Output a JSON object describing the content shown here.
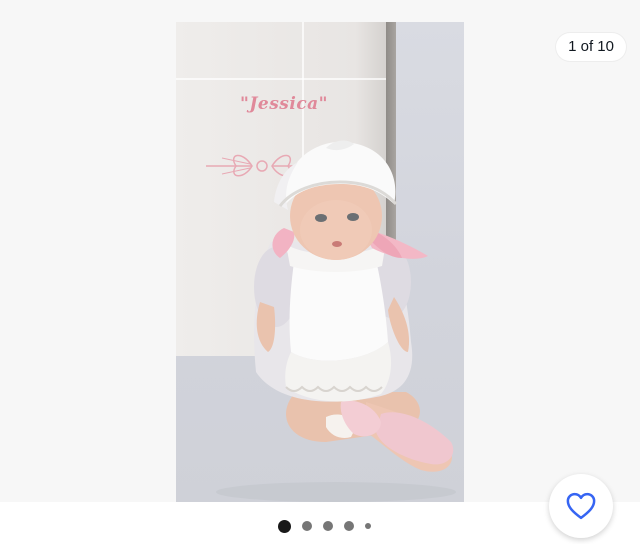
{
  "gallery": {
    "counter_text": "1 of 10",
    "box_label": "\"Jessica\"",
    "current_index": 1,
    "total_images": 10,
    "dots": [
      "active",
      "normal",
      "normal",
      "normal",
      "small"
    ]
  },
  "favorite": {
    "icon": "heart-outline-icon",
    "color": "#3665f3"
  },
  "colors": {
    "box_text": "#e0899a",
    "dot_active": "#191919",
    "dot_inactive": "#767676"
  }
}
